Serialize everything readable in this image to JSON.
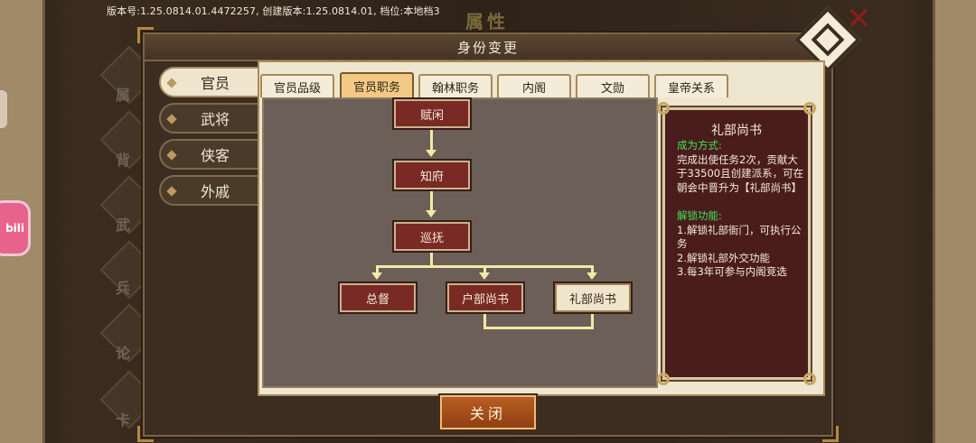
{
  "version_info": "版本号:1.25.0814.01.4472257, 创建版本:1.25.0814.01, 档位:本地档3",
  "background": {
    "title": "属性",
    "side_labels": [
      "属",
      "背",
      "武",
      "兵",
      "论",
      "卡"
    ],
    "badge": "bili"
  },
  "dialog": {
    "title": "身份变更",
    "close_label": "关闭"
  },
  "categories": [
    "官员",
    "武将",
    "侠客",
    "外戚"
  ],
  "sub_tabs": [
    "官员品级",
    "官员职务",
    "翰林职务",
    "内阁",
    "文勋",
    "皇帝关系"
  ],
  "tree": {
    "nodes": [
      "赋闲",
      "知府",
      "巡抚",
      "总督",
      "户部尚书",
      "礼部尚书"
    ],
    "selected": "礼部尚书"
  },
  "info": {
    "title": "礼部尚书",
    "method_header": "成为方式:",
    "method_text": "完成出使任务2次，贡献大于33500且创建派系，可在朝会中晋升为【礼部尚书】",
    "unlock_header": "解锁功能:",
    "unlock_items": [
      "1.解锁礼部衙门，可执行公务",
      "2.解锁礼部外交功能",
      "3.每3年可参与内阁竞选"
    ]
  },
  "colors": {
    "accent_green": "#3ee25a",
    "node_red": "#7a2a25",
    "close_orange": "#b95e22"
  }
}
